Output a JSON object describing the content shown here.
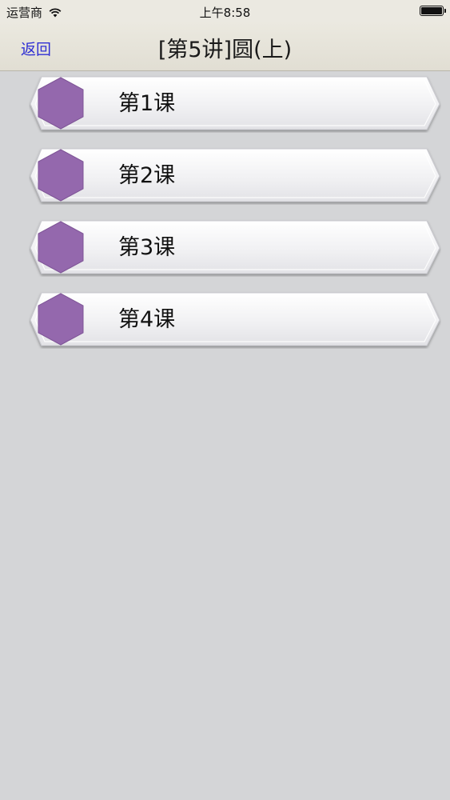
{
  "status_bar": {
    "carrier": "运营商",
    "time": "上午8:58",
    "wifi_icon": "wifi-icon",
    "battery_icon": "battery-icon"
  },
  "nav": {
    "back_label": "返回",
    "title": "[第5讲]圆(上)"
  },
  "lessons": [
    {
      "label": "第1课"
    },
    {
      "label": "第2课"
    },
    {
      "label": "第3课"
    },
    {
      "label": "第4课"
    }
  ],
  "colors": {
    "hexagon": "#9468ad",
    "background": "#d4d5d7",
    "back_link": "#2f2fd3"
  }
}
